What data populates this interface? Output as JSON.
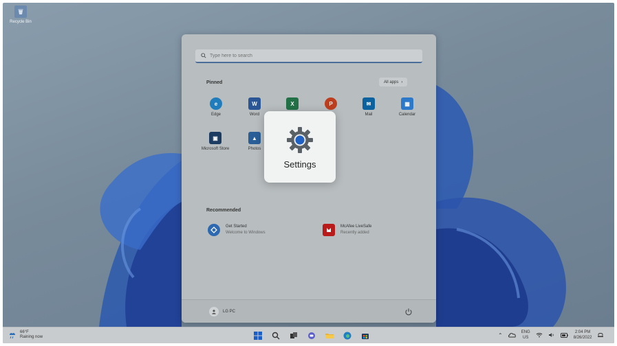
{
  "desktop": {
    "recycle_bin_label": "Recycle Bin"
  },
  "start_menu": {
    "search_placeholder": "Type here to search",
    "pinned_title": "Pinned",
    "all_apps_label": "All apps",
    "pinned": [
      {
        "label": "Edge",
        "icon": "edge-icon",
        "color": "#1f7fc1"
      },
      {
        "label": "Word",
        "icon": "word-icon",
        "color": "#2b579a"
      },
      {
        "label": "Excel",
        "icon": "excel-icon",
        "color": "#217346"
      },
      {
        "label": "PowerPoint",
        "icon": "powerpoint-icon",
        "color": "#c43e1c"
      },
      {
        "label": "Mail",
        "icon": "mail-icon",
        "color": "#0a64a4"
      },
      {
        "label": "Calendar",
        "icon": "calendar-icon",
        "color": "#2c7cd1"
      },
      {
        "label": "Microsoft Store",
        "icon": "store-icon",
        "color": "#1b3b63"
      },
      {
        "label": "Photos",
        "icon": "photos-icon",
        "color": "#2a5f9a"
      }
    ],
    "recommended_title": "Recommended",
    "recommended": [
      {
        "title": "Get Started",
        "subtitle": "Welcome to Windows",
        "icon": "get-started-icon",
        "color": "#2d6bb6"
      },
      {
        "title": "McAfee LiveSafe",
        "subtitle": "Recently added",
        "icon": "mcafee-icon",
        "color": "#c01818"
      }
    ],
    "user_name": "LG PC"
  },
  "highlight": {
    "label": "Settings",
    "icon": "settings-gear-icon"
  },
  "taskbar": {
    "weather_temp": "66°F",
    "weather_desc": "Raining now",
    "lang_top": "ENG",
    "lang_bottom": "US",
    "time": "2:04 PM",
    "date": "8/26/2022"
  }
}
